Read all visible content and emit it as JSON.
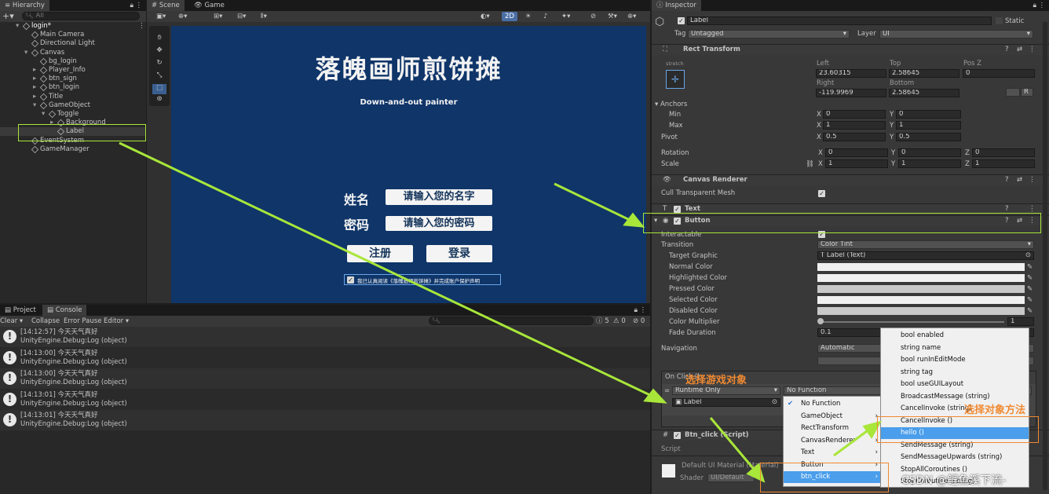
{
  "hierarchy": {
    "tab": "Hierarchy",
    "search_placeholder": "All",
    "items": [
      {
        "label": "login*",
        "depth": 0
      },
      {
        "label": "Main Camera",
        "depth": 1
      },
      {
        "label": "Directional Light",
        "depth": 1
      },
      {
        "label": "Canvas",
        "depth": 1
      },
      {
        "label": "bg_login",
        "depth": 2
      },
      {
        "label": "Player_Info",
        "depth": 2
      },
      {
        "label": "btn_sign",
        "depth": 2
      },
      {
        "label": "btn_login",
        "depth": 2
      },
      {
        "label": "Title",
        "depth": 2
      },
      {
        "label": "GameObject",
        "depth": 2
      },
      {
        "label": "Toggle",
        "depth": 3
      },
      {
        "label": "Background",
        "depth": 4
      },
      {
        "label": "Label",
        "depth": 4
      },
      {
        "label": "EventSystem",
        "depth": 1
      },
      {
        "label": "GameManager",
        "depth": 1
      }
    ]
  },
  "scene": {
    "tab_scene": "Scene",
    "tab_game": "Game",
    "mode_2d": "2D",
    "title": "落魄画师煎饼摊",
    "subtitle": "Down-and-out painter",
    "name_label": "姓名",
    "name_placeholder": "请输入您的名字",
    "pwd_label": "密码",
    "pwd_placeholder": "请输入您的密码",
    "btn_register": "注册",
    "btn_login": "登录",
    "toggle_text": "我已认真阅读《落魄画师煎饼摊》并完成账户保护声明"
  },
  "console": {
    "tab_project": "Project",
    "tab_console": "Console",
    "clear": "Clear",
    "collapse": "Collapse",
    "error_pause": "Error Pause",
    "editor": "Editor",
    "count_log": "5",
    "count_warn": "0",
    "count_err": "0",
    "entries": [
      {
        "time": "[14:12:57] 今天天气真好",
        "detail": "UnityEngine.Debug:Log (object)"
      },
      {
        "time": "[14:13:00] 今天天气真好",
        "detail": "UnityEngine.Debug:Log (object)"
      },
      {
        "time": "[14:13:00] 今天天气真好",
        "detail": "UnityEngine.Debug:Log (object)"
      },
      {
        "time": "[14:13:01] 今天天气真好",
        "detail": "UnityEngine.Debug:Log (object)"
      },
      {
        "time": "[14:13:01] 今天天气真好",
        "detail": "UnityEngine.Debug:Log (object)"
      }
    ]
  },
  "inspector": {
    "tab": "Inspector",
    "object_name": "Label",
    "static": "Static",
    "tag_label": "Tag",
    "tag_value": "Untagged",
    "layer_label": "Layer",
    "layer_value": "UI",
    "rect_transform": "Rect Transform",
    "stretch": "stretch",
    "left_label": "Left",
    "left_value": "23.60315",
    "top_label": "Top",
    "top_value": "2.58645",
    "posz_label": "Pos Z",
    "posz_value": "0",
    "right_label": "Right",
    "right_value": "-119.9969",
    "bottom_label": "Bottom",
    "bottom_value": "2.58645",
    "btn_r": "R",
    "anchors": "Anchors",
    "min": "Min",
    "min_x": "0",
    "min_y": "0",
    "max": "Max",
    "max_x": "1",
    "max_y": "1",
    "pivot": "Pivot",
    "pivot_x": "0.5",
    "pivot_y": "0.5",
    "rotation": "Rotation",
    "rot_x": "0",
    "rot_y": "0",
    "rot_z": "0",
    "scale": "Scale",
    "scale_x": "1",
    "scale_y": "1",
    "scale_z": "1",
    "ax": "X",
    "ay": "Y",
    "az": "Z",
    "canvas_renderer": "Canvas Renderer",
    "cull": "Cull Transparent Mesh",
    "text_comp": "Text",
    "button_comp": "Button",
    "interactable": "Interactable",
    "transition": "Transition",
    "transition_value": "Color Tint",
    "target_graphic": "Target Graphic",
    "target_graphic_value": "Label (Text)",
    "normal_color": "Normal Color",
    "highlighted_color": "Highlighted Color",
    "pressed_color": "Pressed Color",
    "selected_color": "Selected Color",
    "disabled_color": "Disabled Color",
    "color_multiplier": "Color Multiplier",
    "color_multiplier_value": "1",
    "fade_duration": "Fade Duration",
    "fade_duration_value": "0.1",
    "navigation": "Navigation",
    "navigation_value": "Automatic",
    "on_click": "On Click ()",
    "runtime_only": "Runtime Only",
    "no_function": "No Function",
    "label_ref": "Label",
    "script_comp": "Btn_click (Script)",
    "script_label": "Script",
    "material": "Default UI Material (Material)",
    "shader_label": "Shader",
    "shader_value": "UI/Default"
  },
  "menu_left": [
    {
      "label": "No Function",
      "checked": true
    },
    {
      "label": "GameObject",
      "arrow": true
    },
    {
      "label": "RectTransform",
      "arrow": true
    },
    {
      "label": "CanvasRenderer",
      "arrow": true
    },
    {
      "label": "Text",
      "arrow": true
    },
    {
      "label": "Button",
      "arrow": true
    },
    {
      "label": "btn_click",
      "arrow": true
    }
  ],
  "menu_right": [
    "bool enabled",
    "string name",
    "bool runInEditMode",
    "string tag",
    "bool useGUILayout",
    "BroadcastMessage (string)",
    "CancelInvoke (string)",
    "CancelInvoke ()",
    "hello ()",
    "SendMessage (string)",
    "SendMessageUpwards (string)",
    "StopAllCoroutines ()",
    "StopCoroutine (string)"
  ],
  "annotations": {
    "select_object": "选择游戏对象",
    "select_method": "选择对象方法",
    "watermark": "CSDN @鲤鱼溪下流-"
  },
  "colors": {
    "accent_green": "#a8e63a",
    "accent_orange": "#f08a32",
    "game_bg": "#0f3569",
    "highlight_blue": "#4a9eeb"
  }
}
